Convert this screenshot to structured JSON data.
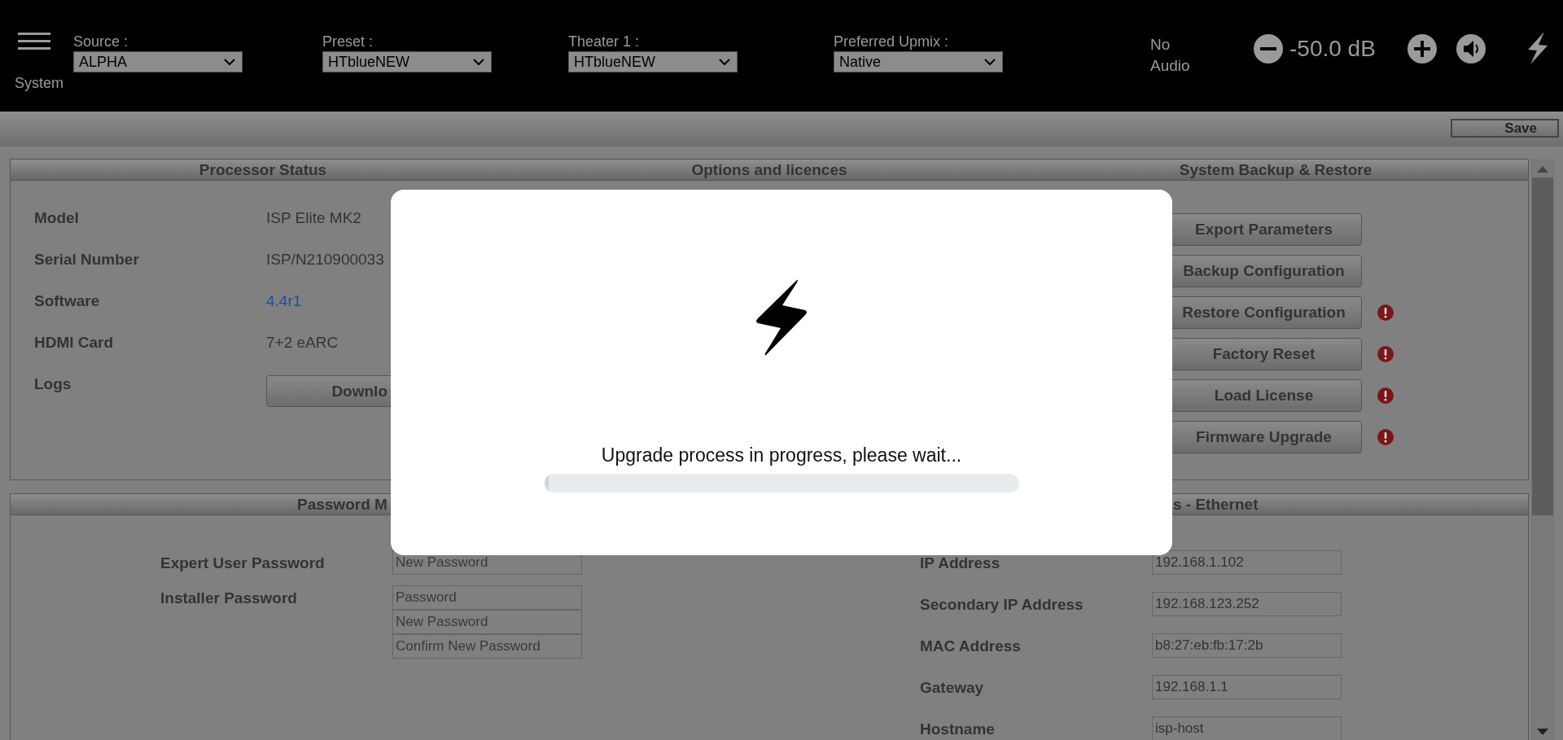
{
  "top_bar": {
    "menu_label": "System",
    "selectors": [
      {
        "label": "Source :",
        "value": "ALPHA"
      },
      {
        "label": "Preset :",
        "value": "HTblueNEW"
      },
      {
        "label": "Theater 1 :",
        "value": "HTblueNEW"
      },
      {
        "label": "Preferred Upmix :",
        "value": "Native"
      }
    ],
    "audio_status": "No Audio",
    "volume": "-50.0 dB"
  },
  "toolbar": {
    "save": "Save"
  },
  "panel_1": {
    "headings": [
      "Processor Status",
      "Options and licences",
      "System Backup & Restore"
    ],
    "status_rows": [
      {
        "label": "Model",
        "value": "ISP Elite MK2",
        "kind": "text"
      },
      {
        "label": "Serial Number",
        "value": "ISP/N210900033",
        "kind": "text"
      },
      {
        "label": "Software",
        "value": "4.4r1",
        "kind": "link"
      },
      {
        "label": "HDMI Card",
        "value": "7+2 eARC",
        "kind": "text"
      }
    ],
    "logs": {
      "label": "Logs",
      "button": "Downlo"
    },
    "backup_buttons": [
      {
        "label": "Export Parameters",
        "warning": false
      },
      {
        "label": "Backup Configuration",
        "warning": false
      },
      {
        "label": "Restore Configuration",
        "warning": true
      },
      {
        "label": "Factory Reset",
        "warning": true
      },
      {
        "label": "Load License",
        "warning": true
      },
      {
        "label": "Firmware Upgrade",
        "warning": true
      }
    ]
  },
  "panel_2": {
    "headings": [
      "Password M",
      "s - Ethernet"
    ],
    "passwords": [
      {
        "label": "Expert User Password",
        "fields": [
          {
            "placeholder": "New Password"
          }
        ]
      },
      {
        "label": "Installer Password",
        "fields": [
          {
            "placeholder": "Password"
          },
          {
            "placeholder": "New Password"
          },
          {
            "placeholder": "Confirm New Password"
          }
        ]
      }
    ],
    "network": [
      {
        "label": "IP Address",
        "value": "192.168.1.102"
      },
      {
        "label": "Secondary IP Address",
        "value": "192.168.123.252"
      },
      {
        "label": "MAC Address",
        "value": "b8:27:eb:fb:17:2b"
      },
      {
        "label": "Gateway",
        "value": "192.168.1.1"
      },
      {
        "label": "Hostname",
        "value": "isp-host"
      }
    ]
  },
  "modal": {
    "message": "Upgrade process in progress, please wait...",
    "level": 0.01
  }
}
